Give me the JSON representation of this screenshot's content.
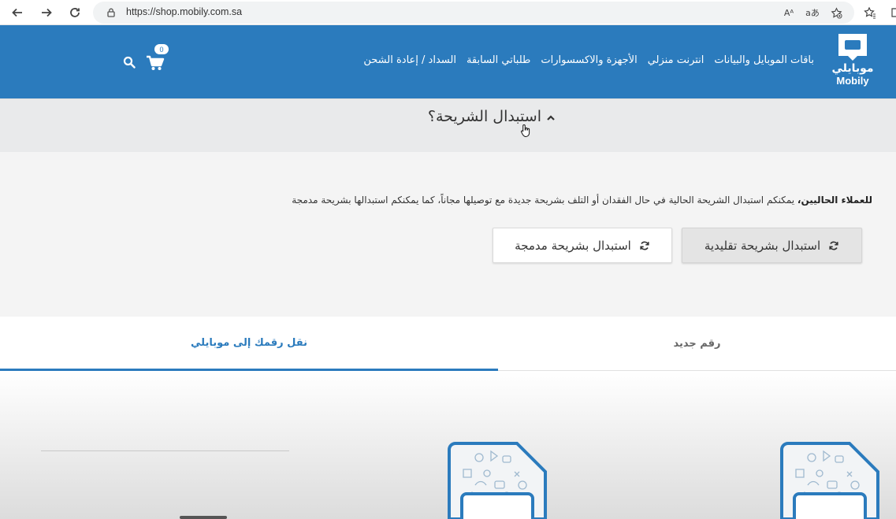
{
  "browser": {
    "url": "https://shop.mobily.com.sa",
    "reader_icon": "Aᴬ",
    "translate_icon": "aあ"
  },
  "header": {
    "logo_ar": "موبايلي",
    "logo_en": "Mobily",
    "nav": [
      "باقات الموبايل والبيانات",
      "انترنت منزلي",
      "الأجهزة والاكسسوارات",
      "طلباتي السابقة",
      "السداد / إعادة الشحن"
    ],
    "cart_count": "0"
  },
  "accordion": {
    "title": "استبدال الشريحة؟",
    "text_bold": "للعملاء الحاليين،",
    "text_rest": " يمكنكم استبدال الشريحة الحالية في حال الفقدان أو التلف بشريحة جديدة مع توصيلها مجاناً، كما يمكنكم استبدالها بشريحة مدمجة",
    "btn_sim": "استبدال بشريحة تقليدية",
    "btn_esim": "استبدال بشريحة مدمجة"
  },
  "tabs": {
    "new_number": "رقم جديد",
    "port_number": "نقل رقمك إلى موبايلي"
  },
  "colors": {
    "brand": "#2b7bbd"
  }
}
